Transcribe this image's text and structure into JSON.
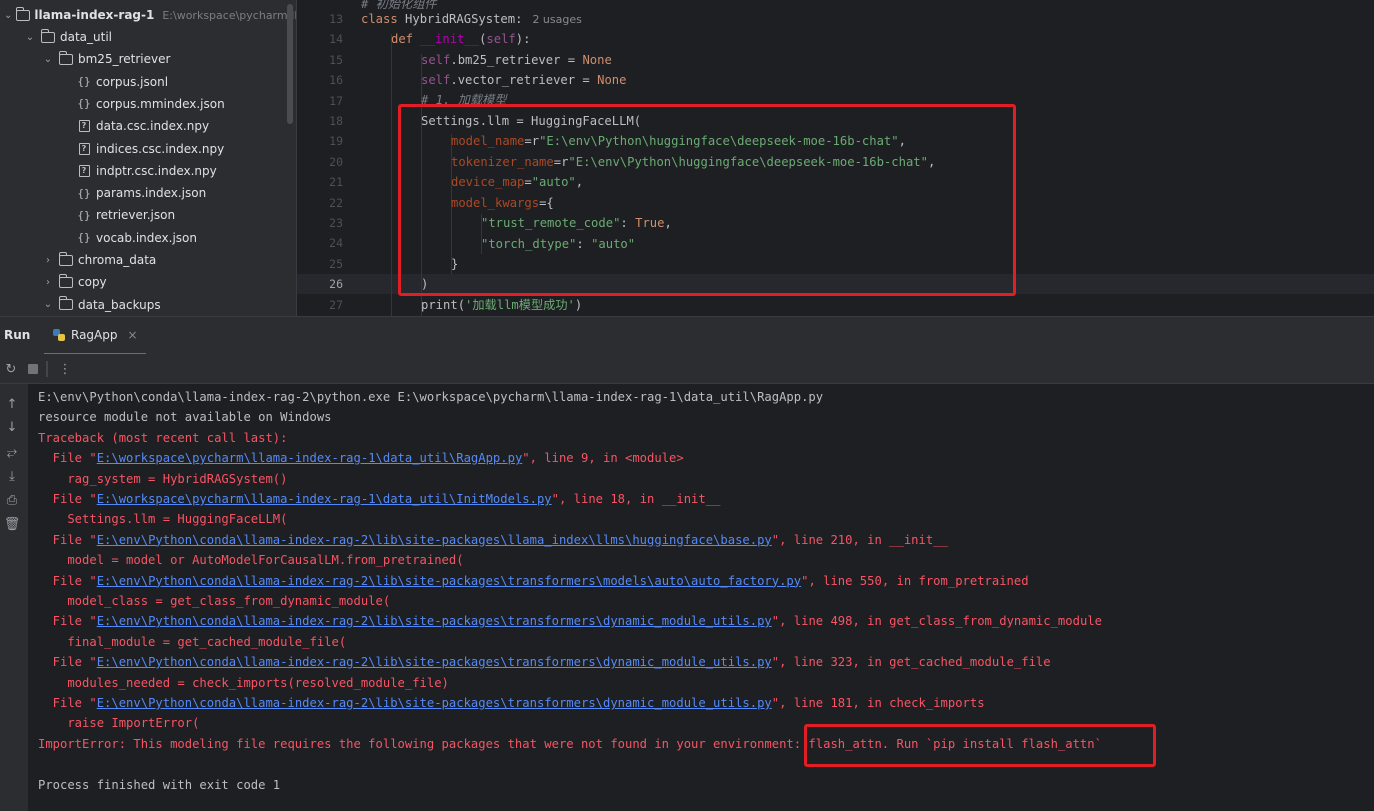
{
  "project_tree": {
    "root": {
      "name": "llama-index-rag-1",
      "path_hint": "E:\\workspace\\pycharm\\llam"
    },
    "items": [
      {
        "label": "data_util",
        "type": "folder",
        "depth": 1,
        "expanded": true
      },
      {
        "label": "bm25_retriever",
        "type": "folder",
        "depth": 2,
        "expanded": true
      },
      {
        "label": "corpus.jsonl",
        "type": "json",
        "depth": 3
      },
      {
        "label": "corpus.mmindex.json",
        "type": "json",
        "depth": 3
      },
      {
        "label": "data.csc.index.npy",
        "type": "npy",
        "depth": 3
      },
      {
        "label": "indices.csc.index.npy",
        "type": "npy",
        "depth": 3
      },
      {
        "label": "indptr.csc.index.npy",
        "type": "npy",
        "depth": 3
      },
      {
        "label": "params.index.json",
        "type": "json",
        "depth": 3
      },
      {
        "label": "retriever.json",
        "type": "json",
        "depth": 3
      },
      {
        "label": "vocab.index.json",
        "type": "json",
        "depth": 3
      },
      {
        "label": "chroma_data",
        "type": "folder",
        "depth": 2,
        "expanded": false
      },
      {
        "label": "copy",
        "type": "folder",
        "depth": 2,
        "expanded": false
      },
      {
        "label": "data_backups",
        "type": "folder",
        "depth": 2,
        "expanded": true
      }
    ]
  },
  "editor": {
    "line_numbers": [
      "13",
      "14",
      "15",
      "16",
      "17",
      "18",
      "19",
      "20",
      "21",
      "22",
      "23",
      "24",
      "25",
      "26",
      "27"
    ],
    "current_line": "26",
    "top_comment": "# 初始化组件",
    "class_decl": {
      "keyword": "class",
      "name": "HybridRAGSystem:",
      "usages": "2 usages"
    },
    "def_decl": {
      "keyword": "def",
      "name": "__init__",
      "open": "(",
      "self": "self",
      "close": "):"
    },
    "bm25": {
      "self": "self",
      "attr": ".bm25_retriever = ",
      "value": "None"
    },
    "vector": {
      "self": "self",
      "attr": ".vector_retriever = ",
      "value": "None"
    },
    "comment_load": "# 1. 加载模型",
    "settings_line": "Settings.llm = HuggingFaceLLM(",
    "model_name": {
      "param": "model_name",
      "eq": "=r",
      "value": "\"E:\\env\\Python\\huggingface\\deepseek-moe-16b-chat\"",
      "tail": ","
    },
    "tokenizer_name": {
      "param": "tokenizer_name",
      "eq": "=r",
      "value": "\"E:\\env\\Python\\huggingface\\deepseek-moe-16b-chat\"",
      "tail": ","
    },
    "device_map": {
      "param": "device_map",
      "eq": "=",
      "value": "\"auto\"",
      "tail": ","
    },
    "model_kwargs": {
      "param": "model_kwargs",
      "eq": "={"
    },
    "trust": {
      "key": "\"trust_remote_code\"",
      "sep": ": ",
      "value": "True",
      "tail": ","
    },
    "dtype": {
      "key": "\"torch_dtype\"",
      "sep": ": ",
      "value": "\"auto\""
    },
    "close_brace": "}",
    "close_paren": ")",
    "print_line": {
      "fn": "print",
      "open": "(",
      "value": "'加载llm模型成功'",
      "close": ")"
    }
  },
  "run_panel": {
    "title": "Run",
    "tab_label": "RagApp",
    "tab_close": "×"
  },
  "console": {
    "lines": [
      {
        "kind": "normal",
        "text": "E:\\env\\Python\\conda\\llama-index-rag-2\\python.exe E:\\workspace\\pycharm\\llama-index-rag-1\\data_util\\RagApp.py"
      },
      {
        "kind": "normal",
        "text": "resource module not available on Windows"
      },
      {
        "kind": "err",
        "text": "Traceback (most recent call last):"
      },
      {
        "kind": "file",
        "pre": "  File \"",
        "link": "E:\\workspace\\pycharm\\llama-index-rag-1\\data_util\\RagApp.py",
        "post": "\", line 9, in <module>"
      },
      {
        "kind": "err",
        "text": "    rag_system = HybridRAGSystem()"
      },
      {
        "kind": "file",
        "pre": "  File \"",
        "link": "E:\\workspace\\pycharm\\llama-index-rag-1\\data_util\\InitModels.py",
        "post": "\", line 18, in __init__"
      },
      {
        "kind": "err",
        "text": "    Settings.llm = HuggingFaceLLM("
      },
      {
        "kind": "file",
        "pre": "  File \"",
        "link": "E:\\env\\Python\\conda\\llama-index-rag-2\\lib\\site-packages\\llama_index\\llms\\huggingface\\base.py",
        "post": "\", line 210, in __init__"
      },
      {
        "kind": "err",
        "text": "    model = model or AutoModelForCausalLM.from_pretrained("
      },
      {
        "kind": "file",
        "pre": "  File \"",
        "link": "E:\\env\\Python\\conda\\llama-index-rag-2\\lib\\site-packages\\transformers\\models\\auto\\auto_factory.py",
        "post": "\", line 550, in from_pretrained"
      },
      {
        "kind": "err",
        "text": "    model_class = get_class_from_dynamic_module("
      },
      {
        "kind": "file",
        "pre": "  File \"",
        "link": "E:\\env\\Python\\conda\\llama-index-rag-2\\lib\\site-packages\\transformers\\dynamic_module_utils.py",
        "post": "\", line 498, in get_class_from_dynamic_module"
      },
      {
        "kind": "err",
        "text": "    final_module = get_cached_module_file("
      },
      {
        "kind": "file",
        "pre": "  File \"",
        "link": "E:\\env\\Python\\conda\\llama-index-rag-2\\lib\\site-packages\\transformers\\dynamic_module_utils.py",
        "post": "\", line 323, in get_cached_module_file"
      },
      {
        "kind": "err",
        "text": "    modules_needed = check_imports(resolved_module_file)"
      },
      {
        "kind": "file",
        "pre": "  File \"",
        "link": "E:\\env\\Python\\conda\\llama-index-rag-2\\lib\\site-packages\\transformers\\dynamic_module_utils.py",
        "post": "\", line 181, in check_imports"
      },
      {
        "kind": "err",
        "text": "    raise ImportError("
      },
      {
        "kind": "err",
        "text": "ImportError: This modeling file requires the following packages that were not found in your environment: flash_attn. Run `pip install flash_attn`"
      },
      {
        "kind": "blank",
        "text": ""
      },
      {
        "kind": "normal",
        "text": "Process finished with exit code 1"
      }
    ]
  },
  "colors": {
    "background": "#1e1f22",
    "panel": "#2b2d30",
    "error_text": "#f75464",
    "link": "#548af7",
    "annotation_box": "#e01e23"
  }
}
